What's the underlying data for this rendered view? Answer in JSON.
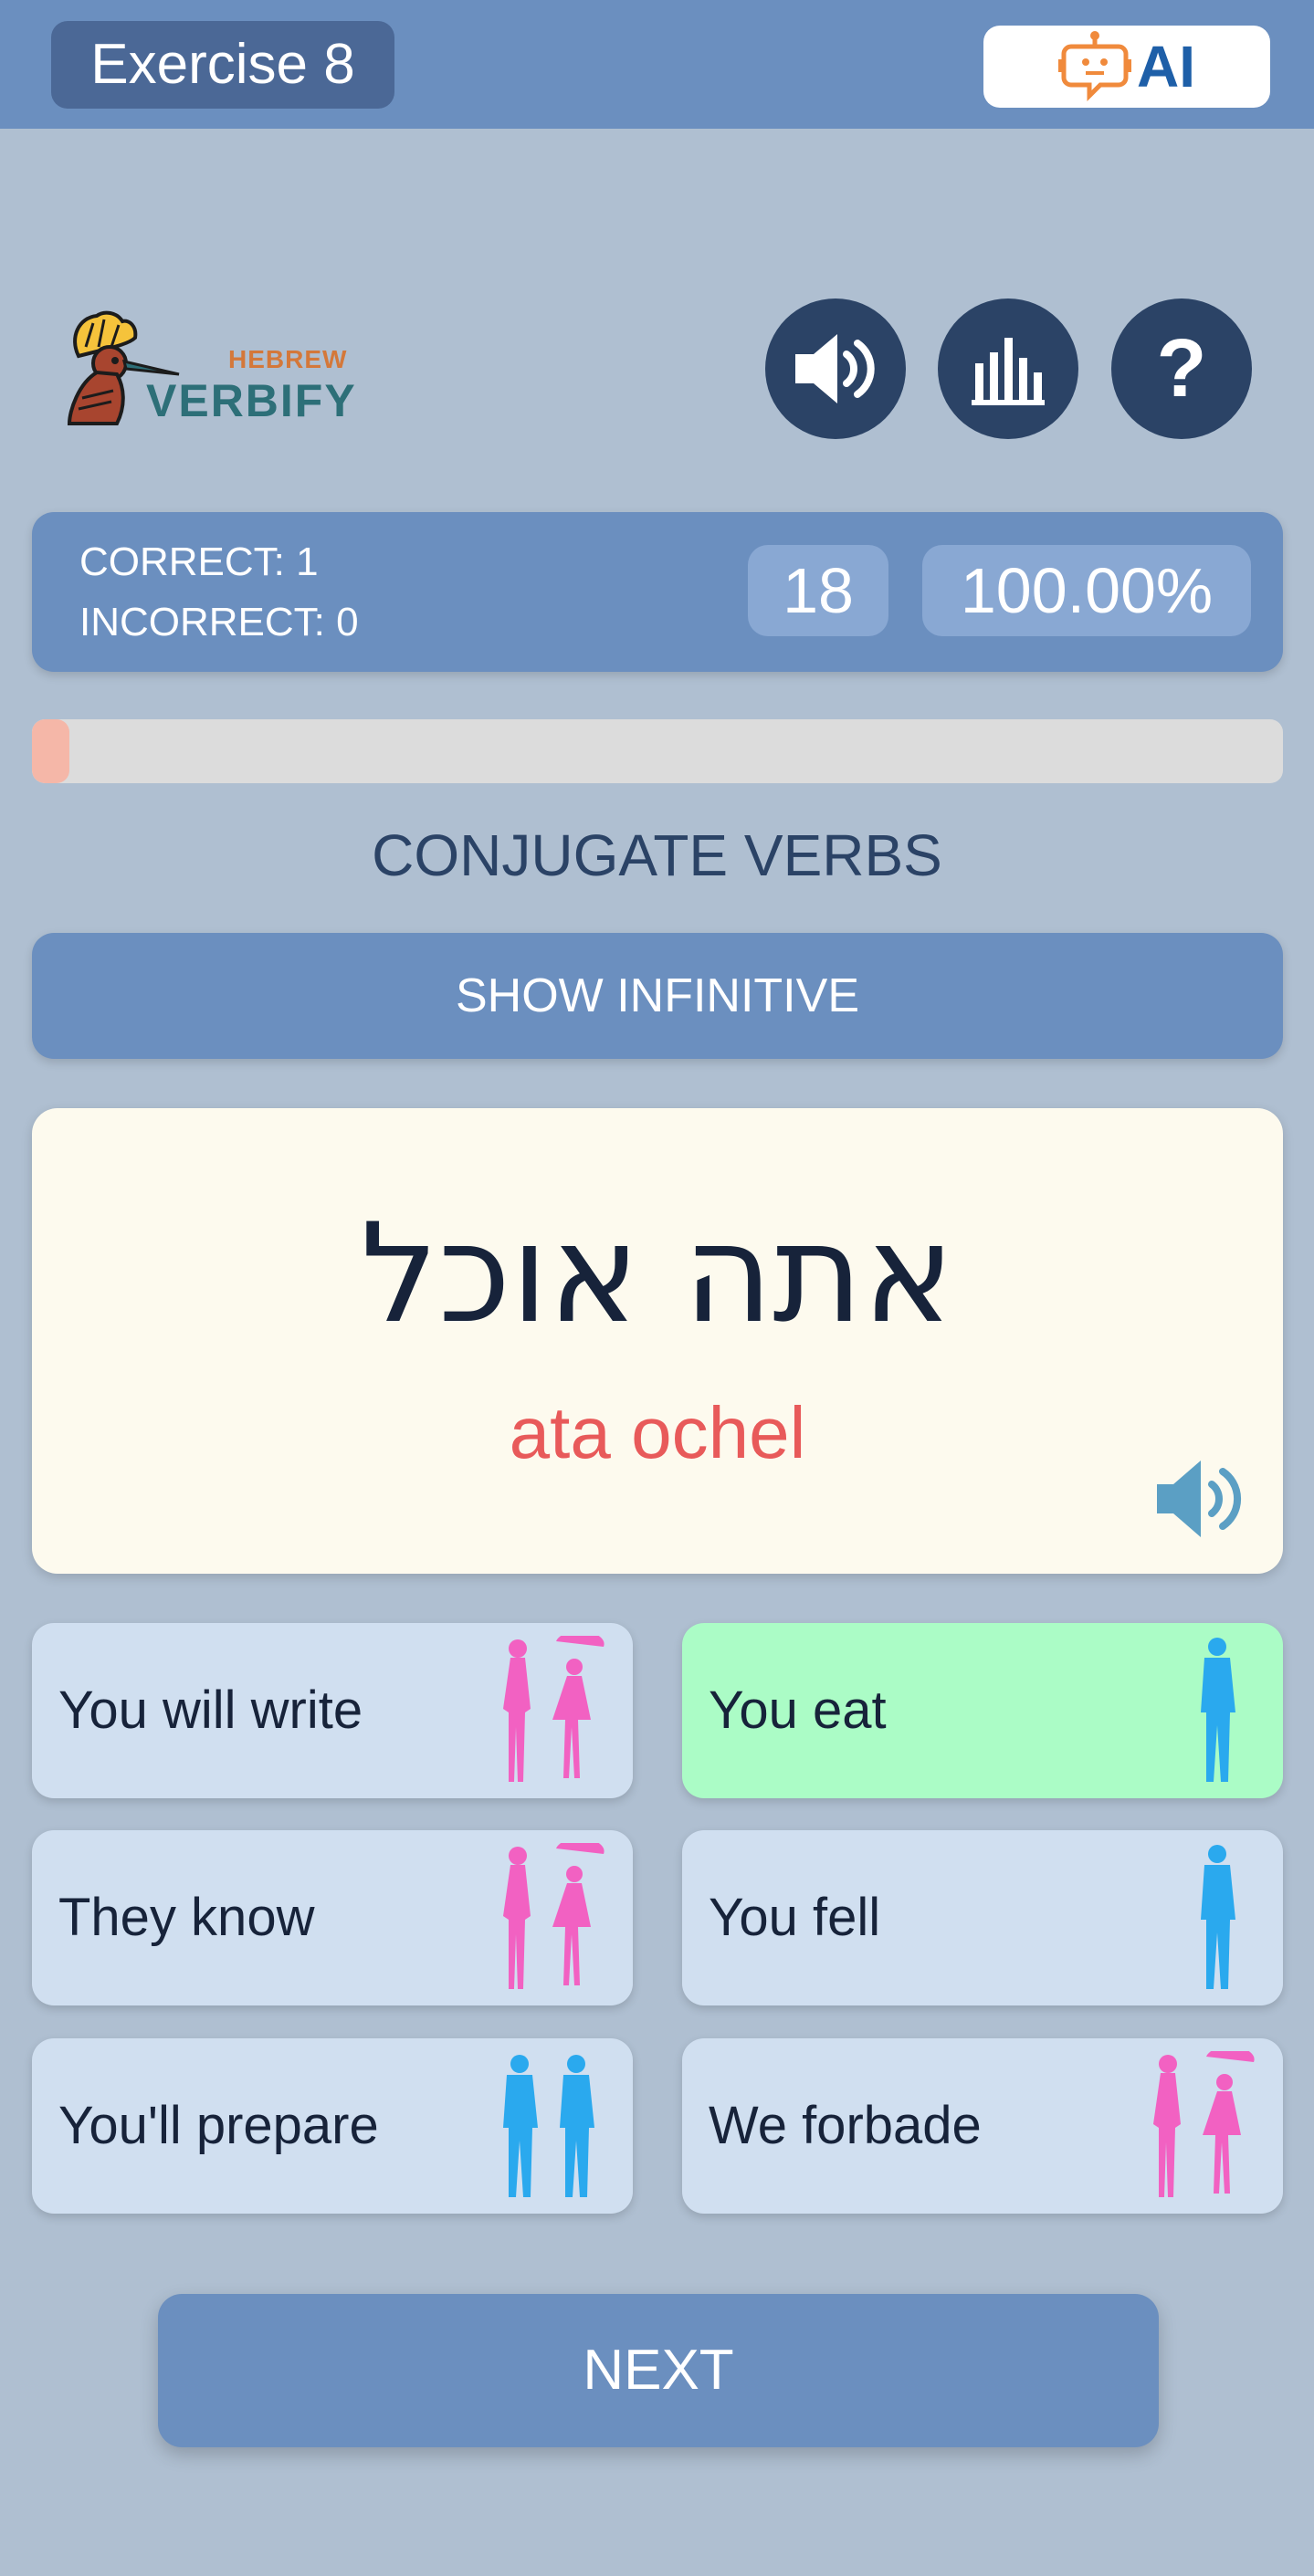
{
  "header": {
    "exercise_title": "Exercise 8",
    "ai_label": "AI"
  },
  "logo": {
    "small_text": "HEBREW",
    "main_text": "VERBIFY"
  },
  "toolbar": {
    "sound_icon": "speaker-icon",
    "stats_icon": "bar-chart-icon",
    "help_label": "?"
  },
  "score": {
    "correct_text": "CORRECT: 1",
    "incorrect_text": "INCORRECT: 0",
    "remaining": "18",
    "accuracy": "100.00%"
  },
  "progress": {
    "fraction": 0.03
  },
  "exercise": {
    "heading": "CONJUGATE VERBS",
    "show_infinitive_label": "SHOW INFINITIVE",
    "hebrew_word": "אתה אוכל",
    "transliteration": "ata ochel"
  },
  "options": [
    {
      "label": "You will write",
      "figure": "female-pair-icon",
      "state": "normal"
    },
    {
      "label": "You eat",
      "figure": "male-single-icon",
      "state": "correct"
    },
    {
      "label": "They know",
      "figure": "female-pair-icon",
      "state": "normal"
    },
    {
      "label": "You fell",
      "figure": "male-single-icon",
      "state": "normal"
    },
    {
      "label": "You'll prepare",
      "figure": "male-pair-icon",
      "state": "normal"
    },
    {
      "label": "We forbade",
      "figure": "female-pair-icon",
      "state": "normal"
    }
  ],
  "next_label": "NEXT",
  "colors": {
    "background": "#afbfd1",
    "primary": "#6b8fbf",
    "dark": "#2b4366",
    "correct": "#abfcc6",
    "option": "#d0dff0",
    "female": "#f261c2",
    "male": "#2aa9ee",
    "transliteration": "#e85a5a"
  }
}
